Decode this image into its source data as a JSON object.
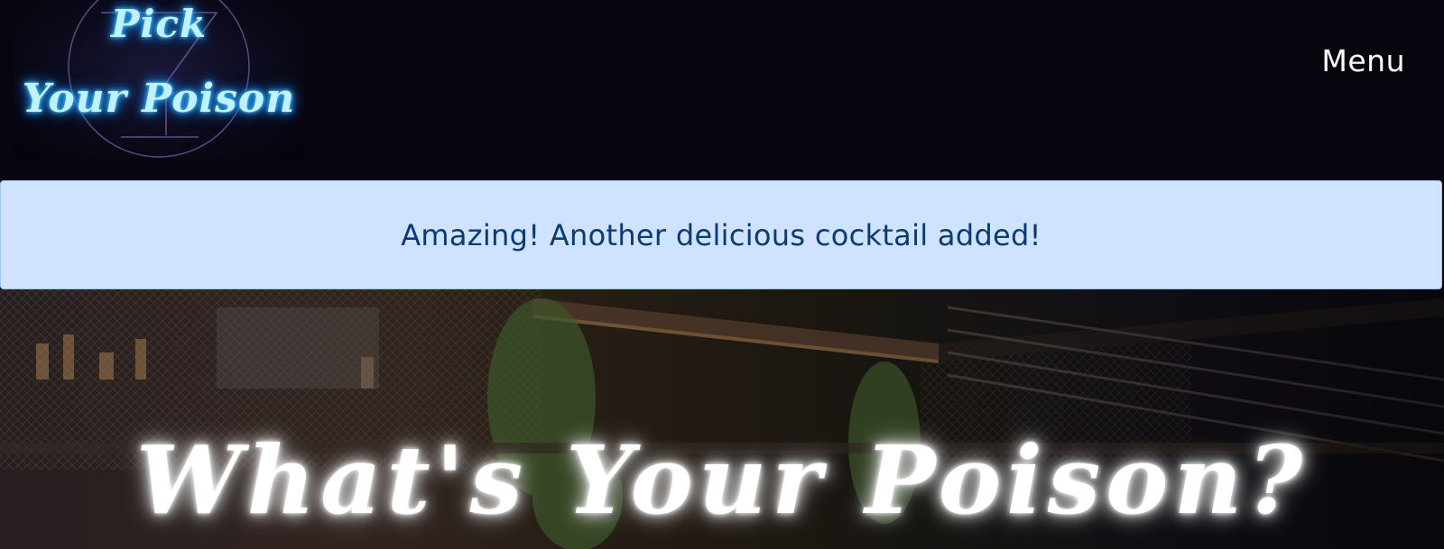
{
  "header": {
    "logo": {
      "line1": "Pick",
      "line2": "Your Poison",
      "neon_color": "#4fd0ff",
      "glass_outline_color": "#6c5a9c"
    },
    "menu_label": "Menu"
  },
  "alert": {
    "message": "Amazing! Another delicious cocktail added!",
    "background_color": "#cfe2ff",
    "text_color": "#0b3a75"
  },
  "hero": {
    "title": "What's Your Poison?",
    "background": "bar-photo"
  },
  "colors": {
    "navbar_background": "#07060f",
    "menu_text": "#ffffff"
  }
}
